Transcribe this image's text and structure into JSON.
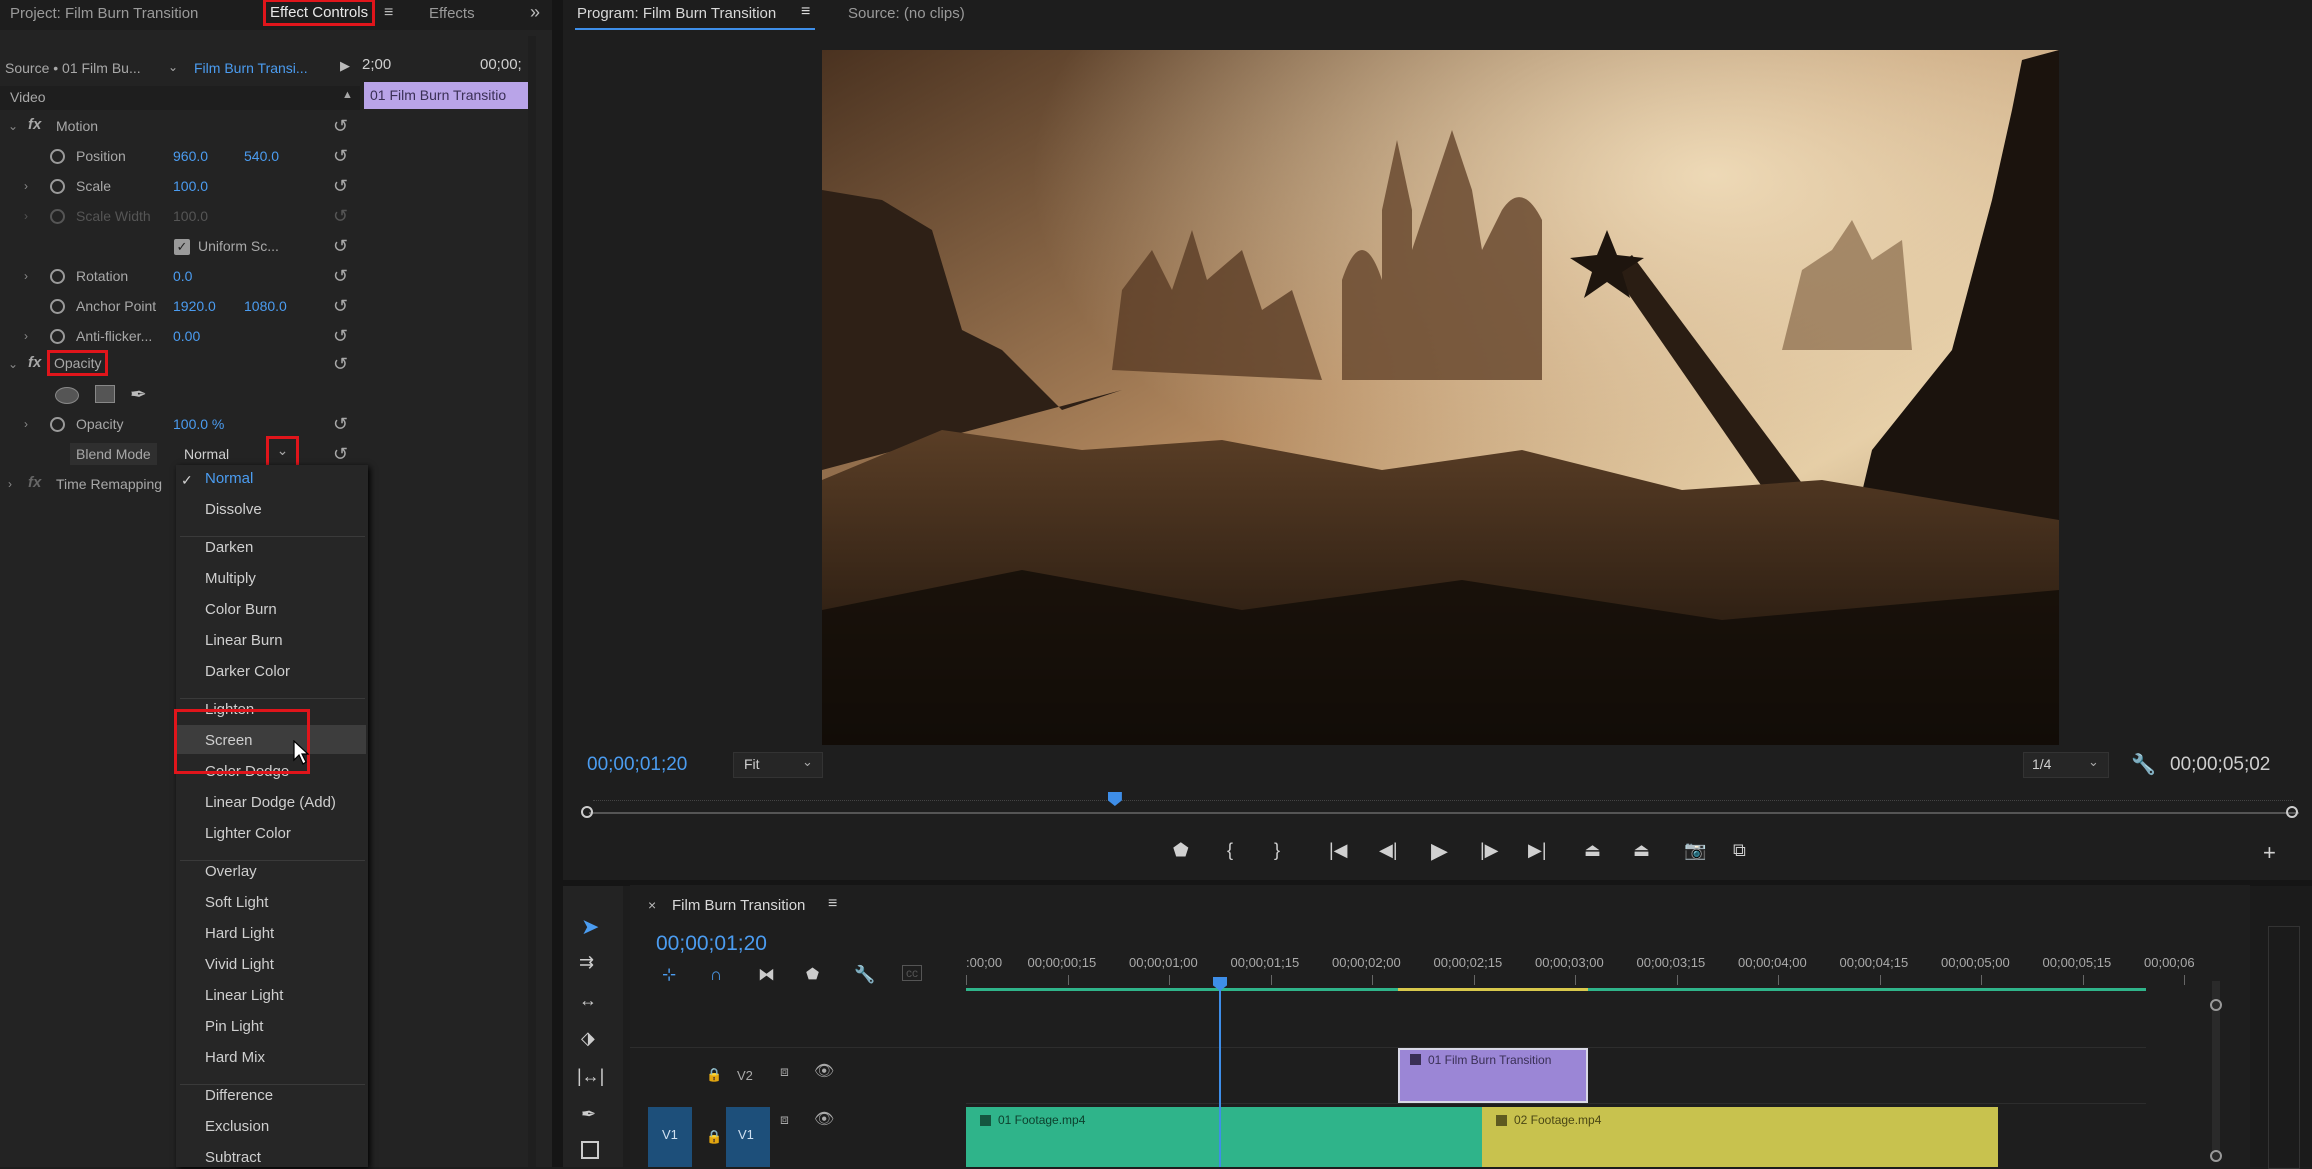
{
  "tabs": {
    "project": "Project: Film Burn Transition",
    "effect_controls": "Effect Controls",
    "effects": "Effects",
    "program": "Program: Film Burn Transition",
    "source": "Source: (no clips)"
  },
  "effect_controls": {
    "source_label": "Source • 01 Film Bu...",
    "sequence_label": "Film Burn Transi...",
    "time_start": "2;00",
    "time_end": "00;00;",
    "clip_label": "01 Film Burn Transitio",
    "section_video": "Video",
    "motion": "Motion",
    "position": {
      "label": "Position",
      "x": "960.0",
      "y": "540.0"
    },
    "scale": {
      "label": "Scale",
      "value": "100.0"
    },
    "scale_width": {
      "label": "Scale Width",
      "value": "100.0"
    },
    "uniform_scale": "Uniform Sc...",
    "rotation": {
      "label": "Rotation",
      "value": "0.0"
    },
    "anchor_point": {
      "label": "Anchor Point",
      "x": "1920.0",
      "y": "1080.0"
    },
    "anti_flicker": {
      "label": "Anti-flicker...",
      "value": "0.00"
    },
    "opacity_effect": "Opacity",
    "opacity": {
      "label": "Opacity",
      "value": "100.0 %"
    },
    "blend_mode": {
      "label": "Blend Mode",
      "value": "Normal"
    },
    "time_remapping": "Time Remapping"
  },
  "blend_menu": {
    "groups": [
      [
        "Normal",
        "Dissolve"
      ],
      [
        "Darken",
        "Multiply",
        "Color Burn",
        "Linear Burn",
        "Darker Color"
      ],
      [
        "Lighten",
        "Screen",
        "Color Dodge",
        "Linear Dodge (Add)",
        "Lighter Color"
      ],
      [
        "Overlay",
        "Soft Light",
        "Hard Light",
        "Vivid Light",
        "Linear Light",
        "Pin Light",
        "Hard Mix"
      ],
      [
        "Difference",
        "Exclusion",
        "Subtract"
      ]
    ],
    "selected": "Normal",
    "hovered": "Screen"
  },
  "program": {
    "timecode": "00;00;01;20",
    "fit": "Fit",
    "resolution": "1/4",
    "duration": "00;00;05;02",
    "playhead_fraction": 0.307
  },
  "timeline": {
    "sequence_name": "Film Burn Transition",
    "timecode": "00;00;01;20",
    "ruler": [
      ":00;00",
      "00;00;00;15",
      "00;00;01;00",
      "00;00;01;15",
      "00;00;02;00",
      "00;00;02;15",
      "00;00;03;00",
      "00;00;03;15",
      "00;00;04;00",
      "00;00;04;15",
      "00;00;05;00",
      "00;00;05;15",
      "00;00;06"
    ],
    "tracks": {
      "v2": "V2",
      "v1_src": "V1",
      "v1": "V1"
    },
    "clips": {
      "transition": "01 Film Burn Transition",
      "footage1": "01 Footage.mp4",
      "footage2": "02 Footage.mp4"
    },
    "colors": {
      "transition": "#9b86d6",
      "footage1": "#2fb48a",
      "footage2": "#c8c24e",
      "playhead": "#3e8ee8"
    }
  }
}
